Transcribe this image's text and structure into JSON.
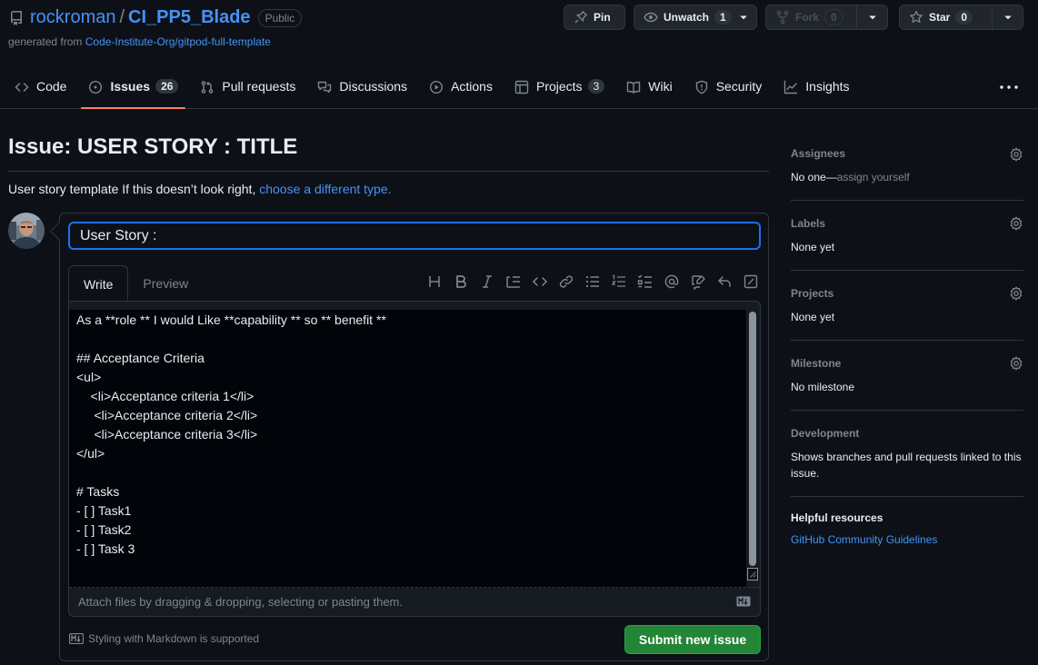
{
  "repo": {
    "owner": "rockroman",
    "slash": "/",
    "name": "CI_PP5_Blade",
    "visibility": "Public",
    "generated_prefix": "generated from",
    "generated_link": "Code-Institute-Org/gitpod-full-template"
  },
  "actions": {
    "pin": "Pin",
    "unwatch": "Unwatch",
    "watch_count": "1",
    "fork": "Fork",
    "fork_count": "0",
    "star": "Star",
    "star_count": "0"
  },
  "tabs": [
    {
      "label": "Code",
      "icon": "code-icon"
    },
    {
      "label": "Issues",
      "icon": "issue-icon",
      "count": "26"
    },
    {
      "label": "Pull requests",
      "icon": "pull-request-icon"
    },
    {
      "label": "Discussions",
      "icon": "discussion-icon"
    },
    {
      "label": "Actions",
      "icon": "play-icon"
    },
    {
      "label": "Projects",
      "icon": "table-icon",
      "count": "3"
    },
    {
      "label": "Wiki",
      "icon": "book-icon"
    },
    {
      "label": "Security",
      "icon": "shield-icon"
    },
    {
      "label": "Insights",
      "icon": "graph-icon"
    }
  ],
  "issue": {
    "heading": "Issue: USER STORY : TITLE",
    "template_text": "User story template If this doesn’t look right, ",
    "template_link": "choose a different type.",
    "title_value": "User Story :",
    "write_tab": "Write",
    "preview_tab": "Preview",
    "body": "As a **role ** I would Like **capability ** so ** benefit **\n\n## Acceptance Criteria\n<ul>\n    <li>Acceptance criteria 1</li>\n     <li>Acceptance criteria 2</li>\n     <li>Acceptance criteria 3</li>\n</ul>\n\n# Tasks\n- [ ] Task1\n- [ ] Task2\n- [ ] Task 3",
    "attach_text": "Attach files by dragging & dropping, selecting or pasting them.",
    "markdown_note": "Styling with Markdown is supported",
    "submit": "Submit new issue"
  },
  "sidebar": {
    "assignees": {
      "heading": "Assignees",
      "value": "No one—",
      "link": "assign yourself"
    },
    "labels": {
      "heading": "Labels",
      "value": "None yet"
    },
    "projects": {
      "heading": "Projects",
      "value": "None yet"
    },
    "milestone": {
      "heading": "Milestone",
      "value": "No milestone"
    },
    "development": {
      "heading": "Development",
      "value": "Shows branches and pull requests linked to this issue."
    },
    "helpful": {
      "heading": "Helpful resources",
      "link": "GitHub Community Guidelines"
    }
  },
  "colors": {
    "background": "#0d1117",
    "link": "#4493f8",
    "active_tab_underline": "#f78166",
    "submit_green": "#238636",
    "focus_blue": "#1f6feb"
  }
}
